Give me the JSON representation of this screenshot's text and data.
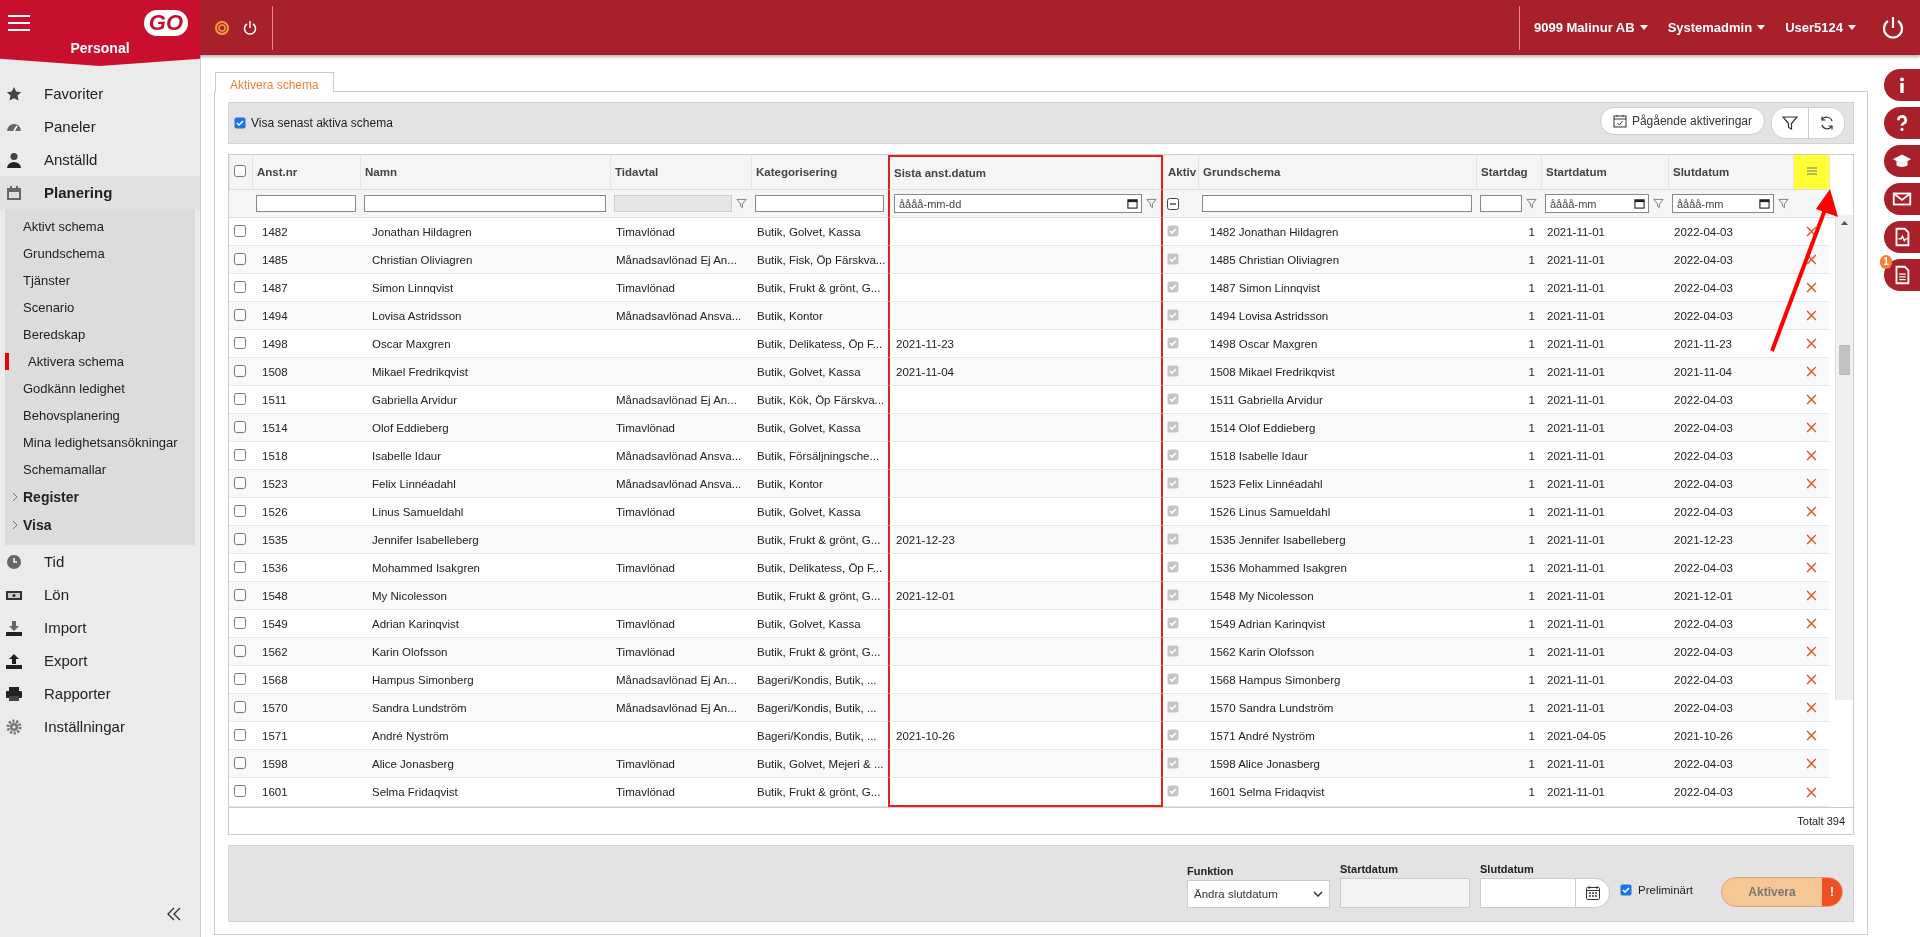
{
  "topbar": {
    "logo": "GO",
    "module": "Personal",
    "company": "9099 Malinur AB",
    "role": "Systemadmin",
    "user": "User5124"
  },
  "sidebar": {
    "items": [
      {
        "label": "Favoriter"
      },
      {
        "label": "Paneler"
      },
      {
        "label": "Anställd"
      },
      {
        "label": "Planering",
        "expanded": true,
        "children": [
          {
            "kind": "link",
            "label": "Aktivt schema",
            "selected": false
          },
          {
            "kind": "link",
            "label": "Grundschema",
            "selected": false
          },
          {
            "kind": "link",
            "label": "Tjänster",
            "selected": false
          },
          {
            "kind": "link",
            "label": "Scenario",
            "selected": false
          },
          {
            "kind": "link",
            "label": "Beredskap",
            "selected": false
          },
          {
            "kind": "link",
            "label": "Aktivera schema",
            "selected": true
          },
          {
            "kind": "link",
            "label": "Godkänn ledighet",
            "selected": false
          },
          {
            "kind": "link",
            "label": "Behovsplanering",
            "selected": false
          },
          {
            "kind": "link",
            "label": "Mina ledighetsansökningar",
            "selected": false
          },
          {
            "kind": "link",
            "label": "Schemamallar",
            "selected": false
          },
          {
            "kind": "group",
            "label": "Register",
            "expanded": false
          },
          {
            "kind": "group",
            "label": "Visa",
            "expanded": false
          }
        ]
      },
      {
        "label": "Tid"
      },
      {
        "label": "Lön"
      },
      {
        "label": "Import"
      },
      {
        "label": "Export"
      },
      {
        "label": "Rapporter"
      },
      {
        "label": "Inställningar"
      }
    ]
  },
  "tabs": [
    {
      "label": "Aktivera schema",
      "selected": true
    }
  ],
  "toolbar": {
    "show_latest": {
      "label": "Visa senast aktiva schema",
      "checked": true
    },
    "ongoing_button": "Pågående aktiveringar"
  },
  "table": {
    "select_all": {
      "checked": false
    },
    "menu_highlighted": true,
    "annotation_arrow": true,
    "columns": [
      {
        "label": "Anst.nr",
        "highlighted": false,
        "filter": {
          "kind": "text"
        }
      },
      {
        "label": "Namn",
        "highlighted": false,
        "filter": {
          "kind": "text"
        }
      },
      {
        "label": "Tidavtal",
        "highlighted": false,
        "filter": {
          "kind": "disabled",
          "funnel": true
        }
      },
      {
        "label": "Kategorisering",
        "highlighted": false,
        "filter": {
          "kind": "text"
        }
      },
      {
        "label": "Sista anst.datum",
        "highlighted": true,
        "filter": {
          "kind": "date",
          "placeholder": "åååå-mm-dd",
          "funnel": true
        }
      },
      {
        "label": "Aktiv",
        "highlighted": false,
        "filter": {
          "kind": "tristate",
          "indeterminate": true
        }
      },
      {
        "label": "Grundschema",
        "highlighted": false,
        "filter": {
          "kind": "text"
        }
      },
      {
        "label": "Startdag",
        "highlighted": false,
        "filter": {
          "kind": "text",
          "funnel": true
        }
      },
      {
        "label": "Startdatum",
        "highlighted": false,
        "filter": {
          "kind": "date",
          "placeholder": "åååå-mm",
          "funnel": true
        }
      },
      {
        "label": "Slutdatum",
        "highlighted": false,
        "filter": {
          "kind": "date",
          "placeholder": "åååå-mm",
          "funnel": true
        }
      }
    ],
    "rows": [
      {
        "selected": false,
        "cells": [
          "1482",
          "Jonathan Hildagren",
          "Timavlönad",
          "Butik, Golvet, Kassa",
          null,
          true,
          "1482 Jonathan Hildagren",
          "1",
          "2021-11-01",
          "2022-04-03"
        ]
      },
      {
        "selected": false,
        "cells": [
          "1485",
          "Christian Oliviagren",
          "Månadsavlönad Ej An...",
          "Butik, Fisk, Öp Färskva...",
          null,
          true,
          "1485 Christian Oliviagren",
          "1",
          "2021-11-01",
          "2022-04-03"
        ]
      },
      {
        "selected": false,
        "cells": [
          "1487",
          "Simon Linnqvist",
          "Timavlönad",
          "Butik, Frukt & grönt, G...",
          null,
          true,
          "1487 Simon Linnqvist",
          "1",
          "2021-11-01",
          "2022-04-03"
        ]
      },
      {
        "selected": false,
        "cells": [
          "1494",
          "Lovisa Astridsson",
          "Månadsavlönad Ansva...",
          "Butik, Kontor",
          null,
          true,
          "1494 Lovisa Astridsson",
          "1",
          "2021-11-01",
          "2022-04-03"
        ]
      },
      {
        "selected": false,
        "cells": [
          "1498",
          "Oscar Maxgren",
          null,
          "Butik, Delikatess, Öp F...",
          "2021-11-23",
          true,
          "1498 Oscar Maxgren",
          "1",
          "2021-11-01",
          "2021-11-23"
        ]
      },
      {
        "selected": false,
        "cells": [
          "1508",
          "Mikael Fredrikqvist",
          null,
          "Butik, Golvet, Kassa",
          "2021-11-04",
          true,
          "1508 Mikael Fredrikqvist",
          "1",
          "2021-11-01",
          "2021-11-04"
        ]
      },
      {
        "selected": false,
        "cells": [
          "1511",
          "Gabriella Arvidur",
          "Månadsavlönad Ej An...",
          "Butik, Kök, Öp Färskva...",
          null,
          true,
          "1511 Gabriella Arvidur",
          "1",
          "2021-11-01",
          "2022-04-03"
        ]
      },
      {
        "selected": false,
        "cells": [
          "1514",
          "Olof Eddieberg",
          "Timavlönad",
          "Butik, Golvet, Kassa",
          null,
          true,
          "1514 Olof Eddieberg",
          "1",
          "2021-11-01",
          "2022-04-03"
        ]
      },
      {
        "selected": false,
        "cells": [
          "1518",
          "Isabelle Idaur",
          "Månadsavlönad Ansva...",
          "Butik, Försäljningsche...",
          null,
          true,
          "1518 Isabelle Idaur",
          "1",
          "2021-11-01",
          "2022-04-03"
        ]
      },
      {
        "selected": false,
        "cells": [
          "1523",
          "Felix Linnéadahl",
          "Månadsavlönad Ansva...",
          "Butik, Kontor",
          null,
          true,
          "1523 Felix Linnéadahl",
          "1",
          "2021-11-01",
          "2022-04-03"
        ]
      },
      {
        "selected": false,
        "cells": [
          "1526",
          "Linus Samueldahl",
          "Timavlönad",
          "Butik, Golvet, Kassa",
          null,
          true,
          "1526 Linus Samueldahl",
          "1",
          "2021-11-01",
          "2022-04-03"
        ]
      },
      {
        "selected": false,
        "cells": [
          "1535",
          "Jennifer Isabelleberg",
          null,
          "Butik, Frukt & grönt, G...",
          "2021-12-23",
          true,
          "1535 Jennifer Isabelleberg",
          "1",
          "2021-11-01",
          "2021-12-23"
        ]
      },
      {
        "selected": false,
        "cells": [
          "1536",
          "Mohammed Isakgren",
          "Timavlönad",
          "Butik, Delikatess, Öp F...",
          null,
          true,
          "1536 Mohammed Isakgren",
          "1",
          "2021-11-01",
          "2022-04-03"
        ]
      },
      {
        "selected": false,
        "cells": [
          "1548",
          "My Nicolesson",
          null,
          "Butik, Frukt & grönt, G...",
          "2021-12-01",
          true,
          "1548 My Nicolesson",
          "1",
          "2021-11-01",
          "2021-12-01"
        ]
      },
      {
        "selected": false,
        "cells": [
          "1549",
          "Adrian Karinqvist",
          "Timavlönad",
          "Butik, Golvet, Kassa",
          null,
          true,
          "1549 Adrian Karinqvist",
          "1",
          "2021-11-01",
          "2022-04-03"
        ]
      },
      {
        "selected": false,
        "cells": [
          "1562",
          "Karin Olofsson",
          "Timavlönad",
          "Butik, Frukt & grönt, G...",
          null,
          true,
          "1562 Karin Olofsson",
          "1",
          "2021-11-01",
          "2022-04-03"
        ]
      },
      {
        "selected": false,
        "cells": [
          "1568",
          "Hampus Simonberg",
          "Månadsavlönad Ej An...",
          "Bageri/Kondis, Butik, ...",
          null,
          true,
          "1568 Hampus Simonberg",
          "1",
          "2021-11-01",
          "2022-04-03"
        ]
      },
      {
        "selected": false,
        "cells": [
          "1570",
          "Sandra Lundström",
          "Månadsavlönad Ej An...",
          "Bageri/Kondis, Butik, ...",
          null,
          true,
          "1570 Sandra Lundström",
          "1",
          "2021-11-01",
          "2022-04-03"
        ]
      },
      {
        "selected": false,
        "cells": [
          "1571",
          "André Nyström",
          null,
          "Bageri/Kondis, Butik, ...",
          "2021-10-26",
          true,
          "1571 André Nyström",
          "1",
          "2021-04-05",
          "2021-10-26"
        ]
      },
      {
        "selected": false,
        "cells": [
          "1598",
          "Alice Jonasberg",
          "Timavlönad",
          "Butik, Golvet, Mejeri & ...",
          null,
          true,
          "1598 Alice Jonasberg",
          "1",
          "2021-11-01",
          "2022-04-03"
        ]
      },
      {
        "selected": false,
        "cells": [
          "1601",
          "Selma Fridaqvist",
          "Timavlönad",
          "Butik, Frukt & grönt, G...",
          null,
          true,
          "1601 Selma Fridaqvist",
          "1",
          "2021-11-01",
          "2022-04-03"
        ]
      }
    ],
    "total": "Totalt 394"
  },
  "footer": {
    "function": {
      "label": "Funktion",
      "value": "Ändra slutdatum"
    },
    "start": {
      "label": "Startdatum",
      "disabled": true
    },
    "end": {
      "label": "Slutdatum"
    },
    "preliminary": {
      "label": "Preliminärt",
      "checked": true
    },
    "activate": {
      "label": "Aktivera",
      "alert": "!"
    }
  },
  "rail": {
    "document_badge": "1"
  }
}
